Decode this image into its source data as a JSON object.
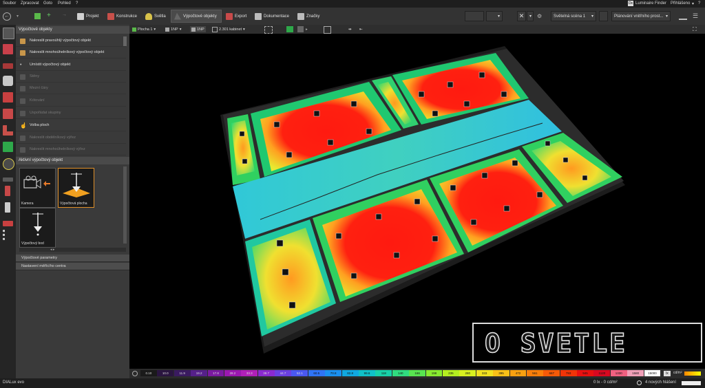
{
  "menubar": {
    "items": [
      "Soubor",
      "Zpracovat",
      "Goto",
      "Pohled",
      "?"
    ],
    "luminaire_finder": "Luminaire Finder",
    "login": "Přihlášeno"
  },
  "toolbar": {
    "tabs": [
      "Projekt",
      "Konstrukce",
      "Světla",
      "Výpočtové objekty",
      "Export",
      "Dokumentace",
      "Značky"
    ],
    "light_scene": "Světelná scéna 1",
    "planning": "Plánování vnitřního prost..."
  },
  "panel": {
    "title": "Výpočtové objekty",
    "items": [
      {
        "label": "Nakreslit pravoúhlý výpočtový objekt",
        "disabled": false
      },
      {
        "label": "Nakreslit mnohoúhelníkový výpočtový objekt",
        "disabled": false
      },
      {
        "label": "Umístit výpočtový objekt",
        "disabled": false
      },
      {
        "label": "Stěny",
        "disabled": true
      },
      {
        "label": "Mezní čáry",
        "disabled": true
      },
      {
        "label": "Kótování",
        "disabled": true
      },
      {
        "label": "Uspořádat skupiny",
        "disabled": true
      },
      {
        "label": "Volba ploch",
        "disabled": false
      },
      {
        "label": "Nakreslit obdélníkový výřez",
        "disabled": true
      },
      {
        "label": "Nakreslit mnohoúhelníkový výřez",
        "disabled": true
      }
    ],
    "active_title": "Aktivní výpočtový objekt",
    "tiles": [
      "Kamera",
      "Výpočtová plocha",
      "Výpočtový bod"
    ],
    "collapsed": [
      "Výpočtové parametry",
      "Nastavení měřícího centra"
    ]
  },
  "viewbar": {
    "surface": "Plocha 1",
    "floor1": "1NP",
    "floor2": "1NP",
    "room": "2.301 kabinet"
  },
  "legend": {
    "values": [
      "0.10",
      "10.0",
      "11.9",
      "19.2",
      "17.8",
      "28.2",
      "33.3",
      "38.7",
      "44.7",
      "52.1",
      "60.5",
      "70.8",
      "82.8",
      "99.6",
      "118",
      "140",
      "166",
      "198",
      "235",
      "280",
      "333",
      "395",
      "472",
      "561",
      "667",
      "793",
      "945",
      "1120",
      "1330",
      "1580",
      "15000"
    ],
    "unit": "cd/m²",
    "colors": [
      "#1a1a1a",
      "#2a1540",
      "#3a1a60",
      "#55208a",
      "#7a1aa0",
      "#9a18b0",
      "#b020b8",
      "#8a2ad0",
      "#6a40e0",
      "#4a58f0",
      "#2f74f5",
      "#1a90f0",
      "#10a8e0",
      "#10c0c8",
      "#18d0a8",
      "#30dc80",
      "#58e450",
      "#88ea30",
      "#b4ee20",
      "#d8f020",
      "#f0e020",
      "#f8c018",
      "#f8a010",
      "#f87e0a",
      "#f55a08",
      "#f03408",
      "#e81010",
      "#d80820",
      "#f06080",
      "#f0a0b8",
      "#ffffff"
    ]
  },
  "status": {
    "app": "DIALux evo",
    "luminance": "0 lx - 0 cd/m²",
    "messages": "4 nových hlášení"
  },
  "watermark": "O SVETLE"
}
